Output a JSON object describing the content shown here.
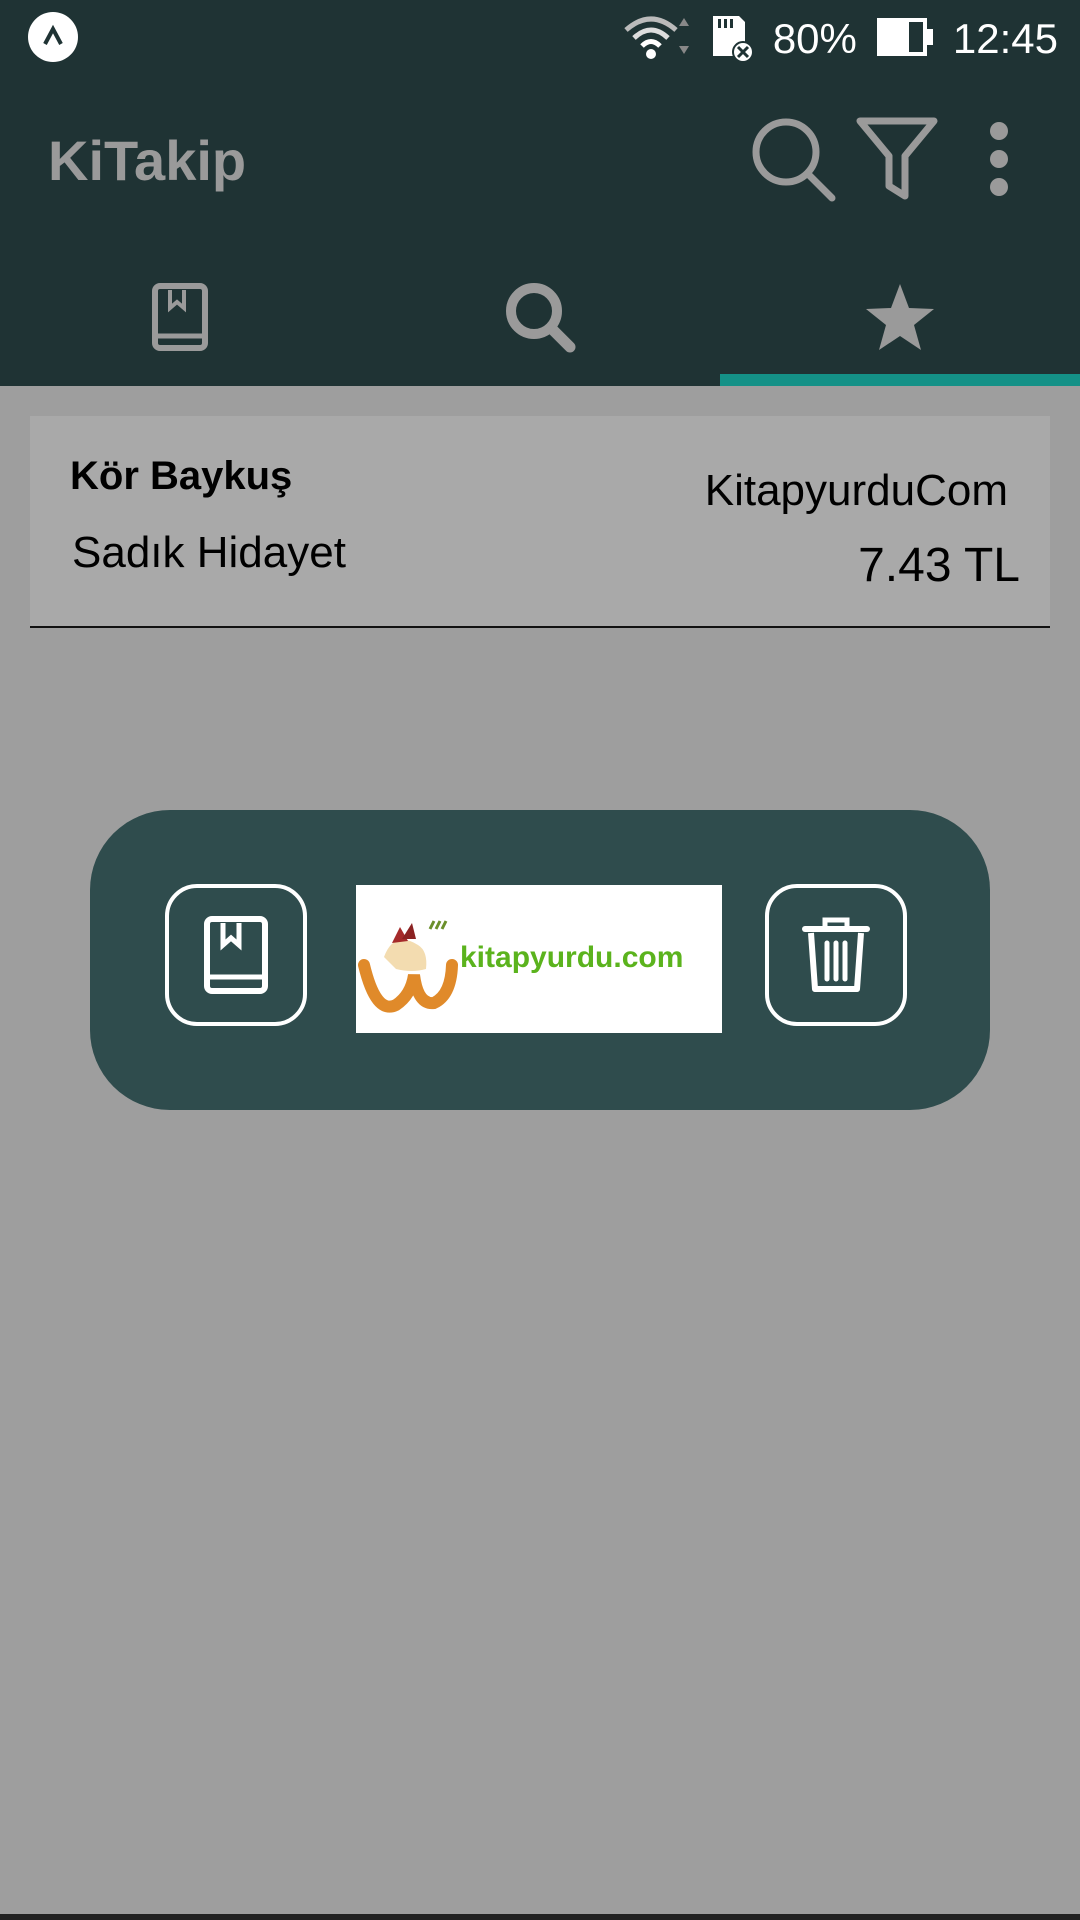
{
  "status_bar": {
    "battery": "80%",
    "time": "12:45"
  },
  "toolbar": {
    "title": "KiTakip"
  },
  "tabs": [
    {
      "name": "books",
      "icon": "book-icon",
      "selected": false
    },
    {
      "name": "search",
      "icon": "search-icon",
      "selected": false
    },
    {
      "name": "favorites",
      "icon": "star-icon",
      "selected": true
    }
  ],
  "list": {
    "items": [
      {
        "title": "Kör Baykuş",
        "author": "Sadık Hidayet",
        "store": "KitapyurduCom",
        "price": "7.43 TL"
      }
    ]
  },
  "dialog": {
    "logo_text": "kitapyurdu.com"
  },
  "colors": {
    "bar": "#1f3334",
    "accent": "#149187",
    "dialog": "#2f4c4d",
    "scrim": "#9e9e9e"
  }
}
